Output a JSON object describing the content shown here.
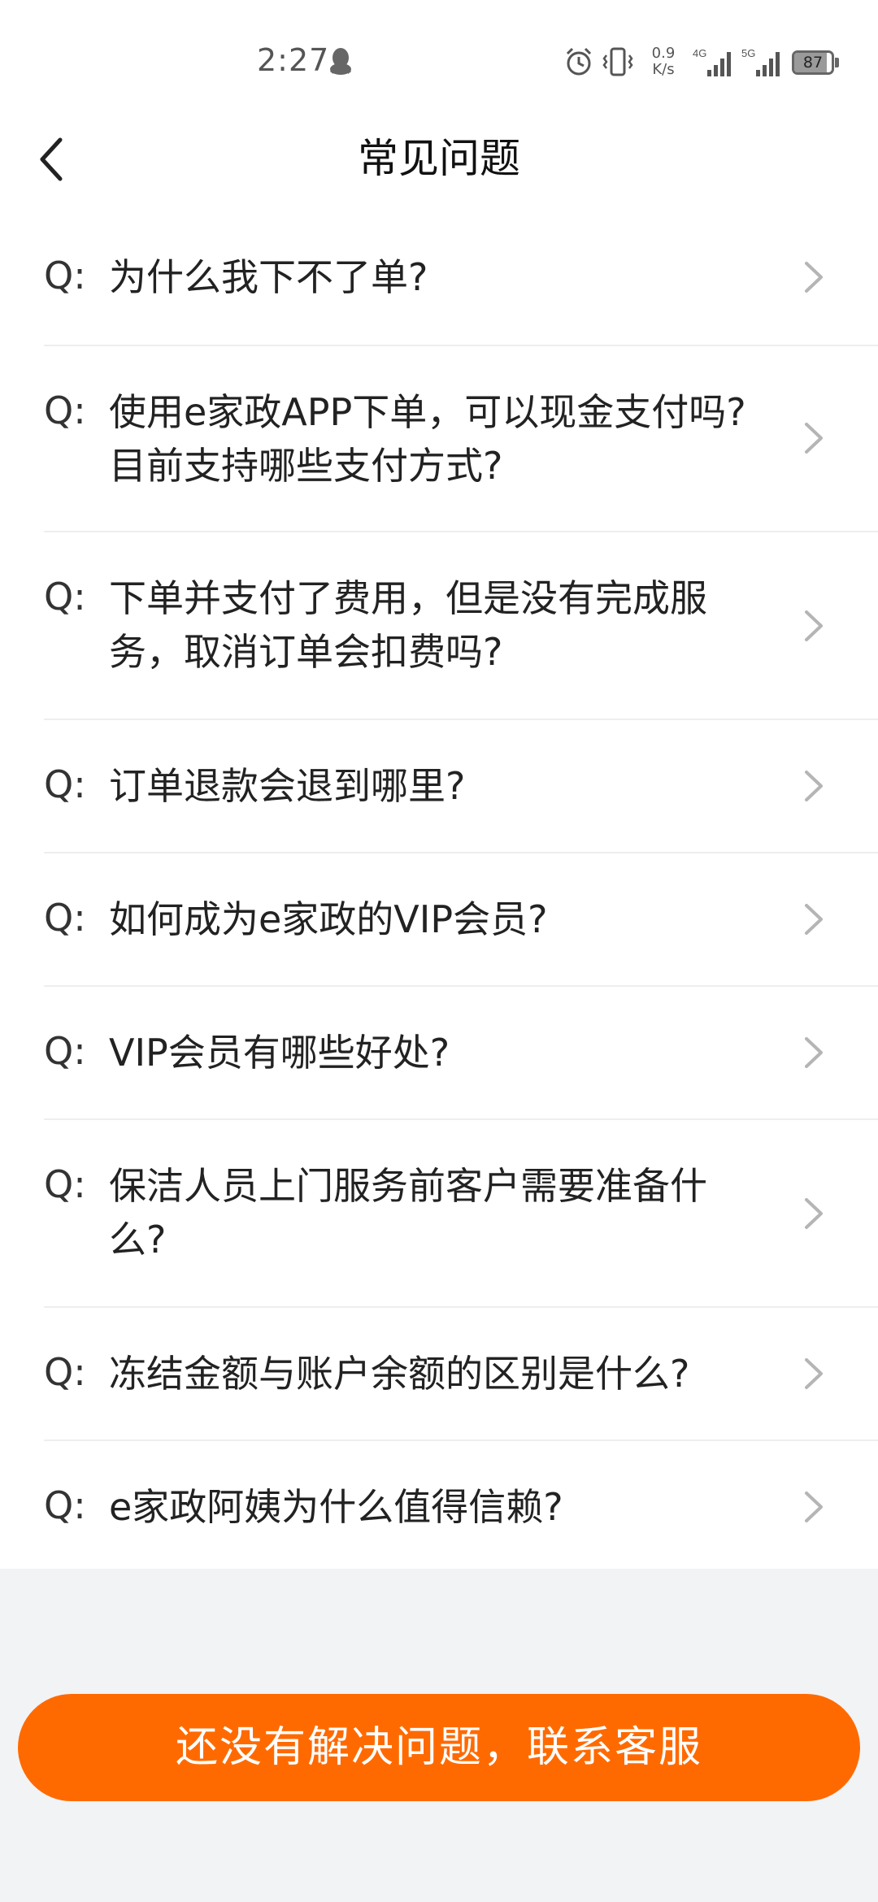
{
  "status_bar": {
    "time": "2:27",
    "net_speed_value": "0.9",
    "net_speed_unit": "K/s",
    "signal_1": "4G",
    "signal_2": "5G",
    "battery": "87",
    "battery_level": 0.87
  },
  "header": {
    "title": "常见问题"
  },
  "faq": {
    "q_prefix": "Q:",
    "items": [
      {
        "line1": "为什么我下不了单?",
        "line2": ""
      },
      {
        "line1": "使用e家政APP下单，可以现金支付吗?",
        "line2": "目前支持哪些支付方式?"
      },
      {
        "line1": "下单并支付了费用，但是没有完成服",
        "line2": "务，取消订单会扣费吗?"
      },
      {
        "line1": "订单退款会退到哪里?",
        "line2": ""
      },
      {
        "line1": "如何成为e家政的VIP会员?",
        "line2": ""
      },
      {
        "line1": "VIP会员有哪些好处?",
        "line2": ""
      },
      {
        "line1": "保洁人员上门服务前客户需要准备什",
        "line2": "么?"
      },
      {
        "line1": "冻结金额与账户余额的区别是什么?",
        "line2": ""
      },
      {
        "line1": "e家政阿姨为什么值得信赖?",
        "line2": ""
      }
    ]
  },
  "footer": {
    "contact_label": "还没有解决问题，联系客服"
  },
  "colors": {
    "accent": "#ff6a00",
    "background": "#f2f3f5",
    "card": "#ffffff"
  }
}
